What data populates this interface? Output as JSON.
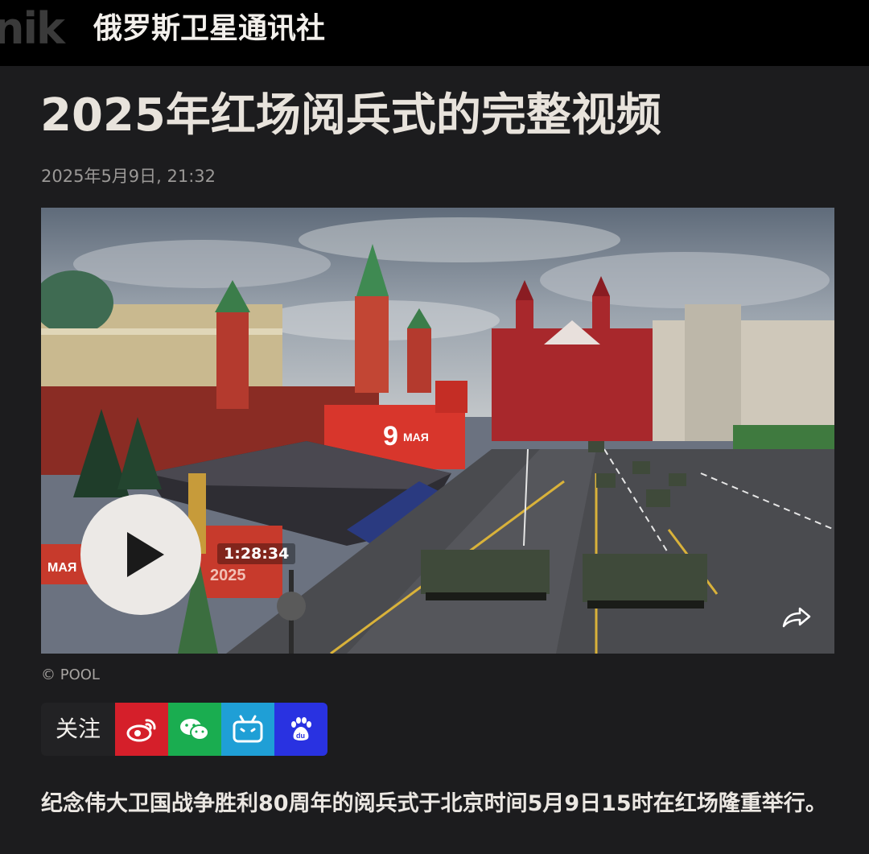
{
  "header": {
    "logo_text": "nik",
    "site_name": "俄罗斯卫星通讯社"
  },
  "article": {
    "title": "2025年红场阅兵式的完整视频",
    "date": "2025年5月9日, 21:32",
    "video": {
      "duration": "1:28:34",
      "banner_text": "9 МАЯ",
      "banner_year": "2025",
      "play_icon": "play-icon",
      "share_icon": "share-icon"
    },
    "credit": "© POOL",
    "follow": {
      "label": "关注",
      "buttons": [
        {
          "name": "weibo",
          "icon": "weibo-icon",
          "color": "#d51f2a"
        },
        {
          "name": "wechat",
          "icon": "wechat-icon",
          "color": "#1aad50"
        },
        {
          "name": "bilibili",
          "icon": "bilibili-icon",
          "color": "#1f9fd6"
        },
        {
          "name": "baidu",
          "icon": "baidu-icon",
          "color": "#2932e1"
        }
      ]
    },
    "lead": "纪念伟大卫国战争胜利80周年的阅兵式于北京时间5月9日15时在红场隆重举行。"
  },
  "colors": {
    "background": "#1c1c1e",
    "topbar": "#000000"
  }
}
